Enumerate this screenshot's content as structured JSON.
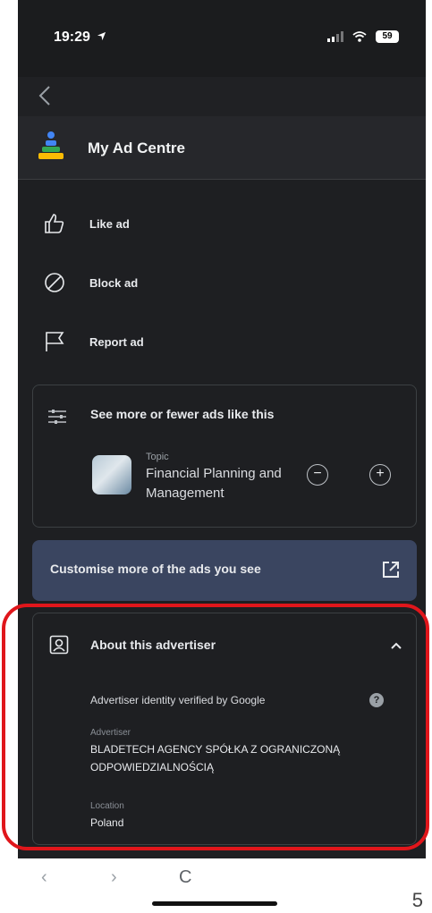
{
  "status_bar": {
    "time": "19:29",
    "battery": "59"
  },
  "header": {
    "title": "My Ad Centre"
  },
  "actions": [
    {
      "label": "Like ad",
      "icon": "thumbs-up-icon"
    },
    {
      "label": "Block ad",
      "icon": "block-icon"
    },
    {
      "label": "Report ad",
      "icon": "flag-icon"
    }
  ],
  "topics_card": {
    "title": "See more or fewer ads like this",
    "topic_label": "Topic",
    "topic_name": "Financial Planning and Management",
    "minus": "−",
    "plus": "+"
  },
  "customise": {
    "label": "Customise more of the ads you see"
  },
  "about": {
    "title": "About this advertiser",
    "verified": "Advertiser identity verified by Google",
    "help": "?",
    "advertiser_label": "Advertiser",
    "advertiser_name": "BLADETECH AGENCY SPÓŁKA Z OGRANICZONĄ ODPOWIEDZIALNOŚCIĄ",
    "location_label": "Location",
    "location": "Poland"
  },
  "bottom_bar": {
    "back": "‹",
    "forward": "›",
    "reload": "C"
  },
  "slide_number": "5",
  "colors": {
    "background": "#1e1f22",
    "accent_panel": "#3a4560",
    "highlight": "#e0161b"
  }
}
